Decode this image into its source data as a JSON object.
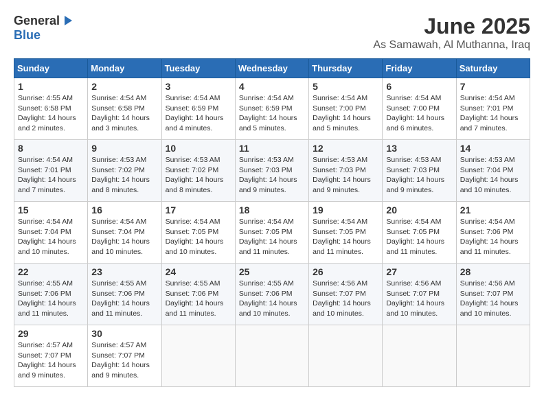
{
  "logo": {
    "general": "General",
    "blue": "Blue"
  },
  "title": "June 2025",
  "location": "As Samawah, Al Muthanna, Iraq",
  "days_header": [
    "Sunday",
    "Monday",
    "Tuesday",
    "Wednesday",
    "Thursday",
    "Friday",
    "Saturday"
  ],
  "weeks": [
    [
      {
        "day": "1",
        "sunrise": "4:55 AM",
        "sunset": "6:58 PM",
        "daylight": "14 hours and 2 minutes."
      },
      {
        "day": "2",
        "sunrise": "4:54 AM",
        "sunset": "6:58 PM",
        "daylight": "14 hours and 3 minutes."
      },
      {
        "day": "3",
        "sunrise": "4:54 AM",
        "sunset": "6:59 PM",
        "daylight": "14 hours and 4 minutes."
      },
      {
        "day": "4",
        "sunrise": "4:54 AM",
        "sunset": "6:59 PM",
        "daylight": "14 hours and 5 minutes."
      },
      {
        "day": "5",
        "sunrise": "4:54 AM",
        "sunset": "7:00 PM",
        "daylight": "14 hours and 5 minutes."
      },
      {
        "day": "6",
        "sunrise": "4:54 AM",
        "sunset": "7:00 PM",
        "daylight": "14 hours and 6 minutes."
      },
      {
        "day": "7",
        "sunrise": "4:54 AM",
        "sunset": "7:01 PM",
        "daylight": "14 hours and 7 minutes."
      }
    ],
    [
      {
        "day": "8",
        "sunrise": "4:54 AM",
        "sunset": "7:01 PM",
        "daylight": "14 hours and 7 minutes."
      },
      {
        "day": "9",
        "sunrise": "4:53 AM",
        "sunset": "7:02 PM",
        "daylight": "14 hours and 8 minutes."
      },
      {
        "day": "10",
        "sunrise": "4:53 AM",
        "sunset": "7:02 PM",
        "daylight": "14 hours and 8 minutes."
      },
      {
        "day": "11",
        "sunrise": "4:53 AM",
        "sunset": "7:03 PM",
        "daylight": "14 hours and 9 minutes."
      },
      {
        "day": "12",
        "sunrise": "4:53 AM",
        "sunset": "7:03 PM",
        "daylight": "14 hours and 9 minutes."
      },
      {
        "day": "13",
        "sunrise": "4:53 AM",
        "sunset": "7:03 PM",
        "daylight": "14 hours and 9 minutes."
      },
      {
        "day": "14",
        "sunrise": "4:53 AM",
        "sunset": "7:04 PM",
        "daylight": "14 hours and 10 minutes."
      }
    ],
    [
      {
        "day": "15",
        "sunrise": "4:54 AM",
        "sunset": "7:04 PM",
        "daylight": "14 hours and 10 minutes."
      },
      {
        "day": "16",
        "sunrise": "4:54 AM",
        "sunset": "7:04 PM",
        "daylight": "14 hours and 10 minutes."
      },
      {
        "day": "17",
        "sunrise": "4:54 AM",
        "sunset": "7:05 PM",
        "daylight": "14 hours and 10 minutes."
      },
      {
        "day": "18",
        "sunrise": "4:54 AM",
        "sunset": "7:05 PM",
        "daylight": "14 hours and 11 minutes."
      },
      {
        "day": "19",
        "sunrise": "4:54 AM",
        "sunset": "7:05 PM",
        "daylight": "14 hours and 11 minutes."
      },
      {
        "day": "20",
        "sunrise": "4:54 AM",
        "sunset": "7:05 PM",
        "daylight": "14 hours and 11 minutes."
      },
      {
        "day": "21",
        "sunrise": "4:54 AM",
        "sunset": "7:06 PM",
        "daylight": "14 hours and 11 minutes."
      }
    ],
    [
      {
        "day": "22",
        "sunrise": "4:55 AM",
        "sunset": "7:06 PM",
        "daylight": "14 hours and 11 minutes."
      },
      {
        "day": "23",
        "sunrise": "4:55 AM",
        "sunset": "7:06 PM",
        "daylight": "14 hours and 11 minutes."
      },
      {
        "day": "24",
        "sunrise": "4:55 AM",
        "sunset": "7:06 PM",
        "daylight": "14 hours and 11 minutes."
      },
      {
        "day": "25",
        "sunrise": "4:55 AM",
        "sunset": "7:06 PM",
        "daylight": "14 hours and 10 minutes."
      },
      {
        "day": "26",
        "sunrise": "4:56 AM",
        "sunset": "7:07 PM",
        "daylight": "14 hours and 10 minutes."
      },
      {
        "day": "27",
        "sunrise": "4:56 AM",
        "sunset": "7:07 PM",
        "daylight": "14 hours and 10 minutes."
      },
      {
        "day": "28",
        "sunrise": "4:56 AM",
        "sunset": "7:07 PM",
        "daylight": "14 hours and 10 minutes."
      }
    ],
    [
      {
        "day": "29",
        "sunrise": "4:57 AM",
        "sunset": "7:07 PM",
        "daylight": "14 hours and 9 minutes."
      },
      {
        "day": "30",
        "sunrise": "4:57 AM",
        "sunset": "7:07 PM",
        "daylight": "14 hours and 9 minutes."
      },
      null,
      null,
      null,
      null,
      null
    ]
  ]
}
